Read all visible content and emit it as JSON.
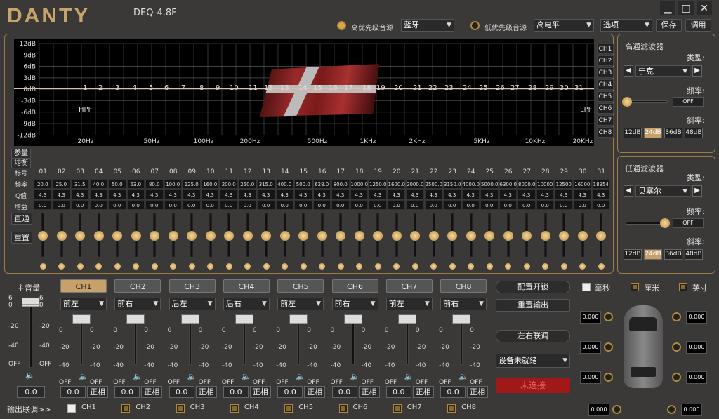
{
  "header": {
    "logo": "DANTY",
    "model": "DEQ-4.8F",
    "high_source_label": "高优先级音源",
    "high_source_value": "蓝牙",
    "low_source_label": "低优先级音源",
    "low_source_value": "高电平",
    "options": "选项",
    "save": "保存",
    "load": "调用",
    "win_min": "▁",
    "win_max": "□",
    "win_close": "✕"
  },
  "graph": {
    "y_labels": [
      "12dB",
      "9dB",
      "6dB",
      "3dB",
      "0dB",
      "-3dB",
      "-6dB",
      "-9dB",
      "-12dB"
    ],
    "x_labels": [
      "20Hz",
      "50Hz",
      "100Hz",
      "200Hz",
      "500Hz",
      "1KHz",
      "2KHz",
      "5KHz",
      "10KHz",
      "20KHz"
    ],
    "band_numbers": [
      "1",
      "2",
      "3",
      "4",
      "5",
      "6",
      "7",
      "8",
      "9",
      "10",
      "11",
      "12",
      "13",
      "14",
      "15",
      "16",
      "17",
      "18",
      "19",
      "20",
      "21",
      "22",
      "23",
      "24",
      "25",
      "26",
      "27",
      "28",
      "29",
      "30",
      "31"
    ],
    "hpf": "HPF",
    "lpf": "LPF",
    "channels": [
      "CH1",
      "CH2",
      "CH3",
      "CH4",
      "CH5",
      "CH6",
      "CH7",
      "CH8"
    ]
  },
  "eq": {
    "param_eq": "参量",
    "graphic_eq": "均衡",
    "row_labels": [
      "标号",
      "频率",
      "Q值",
      "增益"
    ],
    "bands": [
      "01",
      "02",
      "03",
      "04",
      "05",
      "06",
      "07",
      "08",
      "09",
      "10",
      "11",
      "12",
      "13",
      "14",
      "15",
      "16",
      "17",
      "18",
      "19",
      "20",
      "21",
      "22",
      "23",
      "24",
      "25",
      "26",
      "27",
      "28",
      "29",
      "30",
      "31"
    ],
    "freqs": [
      "20.0",
      "25.0",
      "31.5",
      "40.0",
      "50.0",
      "63.0",
      "80.0",
      "100.0",
      "125.0",
      "160.0",
      "200.0",
      "250.0",
      "315.0",
      "400.0",
      "500.0",
      "628.0",
      "800.0",
      "1000.0",
      "1250.0",
      "1600.0",
      "2000.0",
      "2500.0",
      "3150.0",
      "4000.0",
      "5000.0",
      "6300.0",
      "8000.0",
      "10000",
      "12500",
      "16000",
      "18954"
    ],
    "q": "4.3",
    "gain": "0.0",
    "bypass": "直通",
    "reset": "重置"
  },
  "hpf_panel": {
    "title": "高通滤波器",
    "type_label": "类型:",
    "type_value": "宁克",
    "freq_label": "频率:",
    "freq_value": "OFF",
    "slope_label": "斜率:",
    "slopes": [
      "12dB",
      "24dB",
      "36dB",
      "48dB"
    ]
  },
  "lpf_panel": {
    "title": "低通滤波器",
    "type_label": "类型:",
    "type_value": "贝塞尔",
    "freq_label": "频率:",
    "freq_value": "OFF",
    "slope_label": "斜率:",
    "slopes": [
      "12dB",
      "24dB",
      "36dB",
      "48dB"
    ]
  },
  "master": {
    "label": "主音量",
    "scale": [
      "6",
      "0",
      "-20",
      "-40",
      "OFF"
    ],
    "value": "0.0"
  },
  "channels": [
    {
      "tab": "CH1",
      "pos": "前左"
    },
    {
      "tab": "CH2",
      "pos": "前右"
    },
    {
      "tab": "CH3",
      "pos": "后左"
    },
    {
      "tab": "CH4",
      "pos": "后右"
    },
    {
      "tab": "CH5",
      "pos": "前左"
    },
    {
      "tab": "CH6",
      "pos": "前右"
    },
    {
      "tab": "CH7",
      "pos": "前左"
    },
    {
      "tab": "CH8",
      "pos": "前右"
    }
  ],
  "ch_scale": [
    "0",
    "-20",
    "-40",
    "OFF"
  ],
  "ch_value": "0.0",
  "phase": "正相",
  "right_buttons": {
    "lock": "配置开锁",
    "reset_out": "重置输出",
    "lr_link": "左右联调",
    "device": "设备未就绪",
    "status": "未连接"
  },
  "units": {
    "ms": "毫秒",
    "cm": "厘米",
    "inch": "英寸"
  },
  "delays": [
    "0.000",
    "0.000",
    "0.000",
    "0.000",
    "0.000",
    "0.000",
    "0.000",
    "0.000"
  ],
  "link": {
    "label": "输出联调>>",
    "chs": [
      "CH1",
      "CH2",
      "CH3",
      "CH4",
      "CH5",
      "CH6",
      "CH7",
      "CH8"
    ]
  },
  "colors": {
    "accent": "#c7a06a",
    "status_red": "#a01818"
  }
}
